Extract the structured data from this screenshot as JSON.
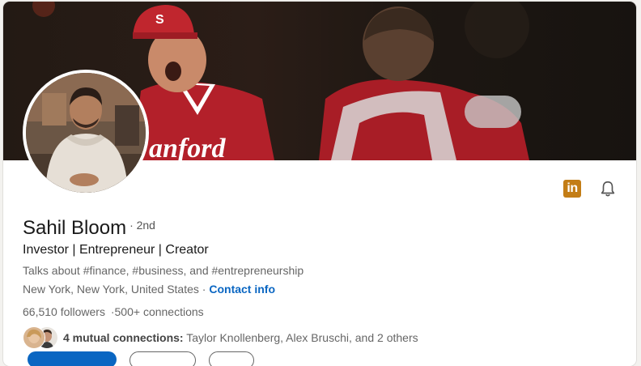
{
  "profile": {
    "name": "Sahil Bloom",
    "degree": "· 2nd",
    "headline": "Investor | Entrepreneur | Creator",
    "talks_about": "Talks about #finance, #business, and #entrepreneurship",
    "location": "New York, New York, United States",
    "location_sep": " · ",
    "contact_label": "Contact info",
    "followers": "66,510 followers",
    "connections_sep": "·",
    "connections": "500+ connections",
    "mutual_bold": "4 mutual connections:",
    "mutual_names": " Taylor Knollenberg, Alex Bruschi, and 2 others"
  },
  "banner": {
    "cap_letter": "S",
    "jersey_text": "anford"
  },
  "icons": {
    "linkedin": "linkedin-logo-icon",
    "bell": "bell-icon"
  },
  "colors": {
    "accent": "#0a66c2",
    "linkedin_badge": "#c37d16",
    "jersey_red": "#b3202a"
  }
}
